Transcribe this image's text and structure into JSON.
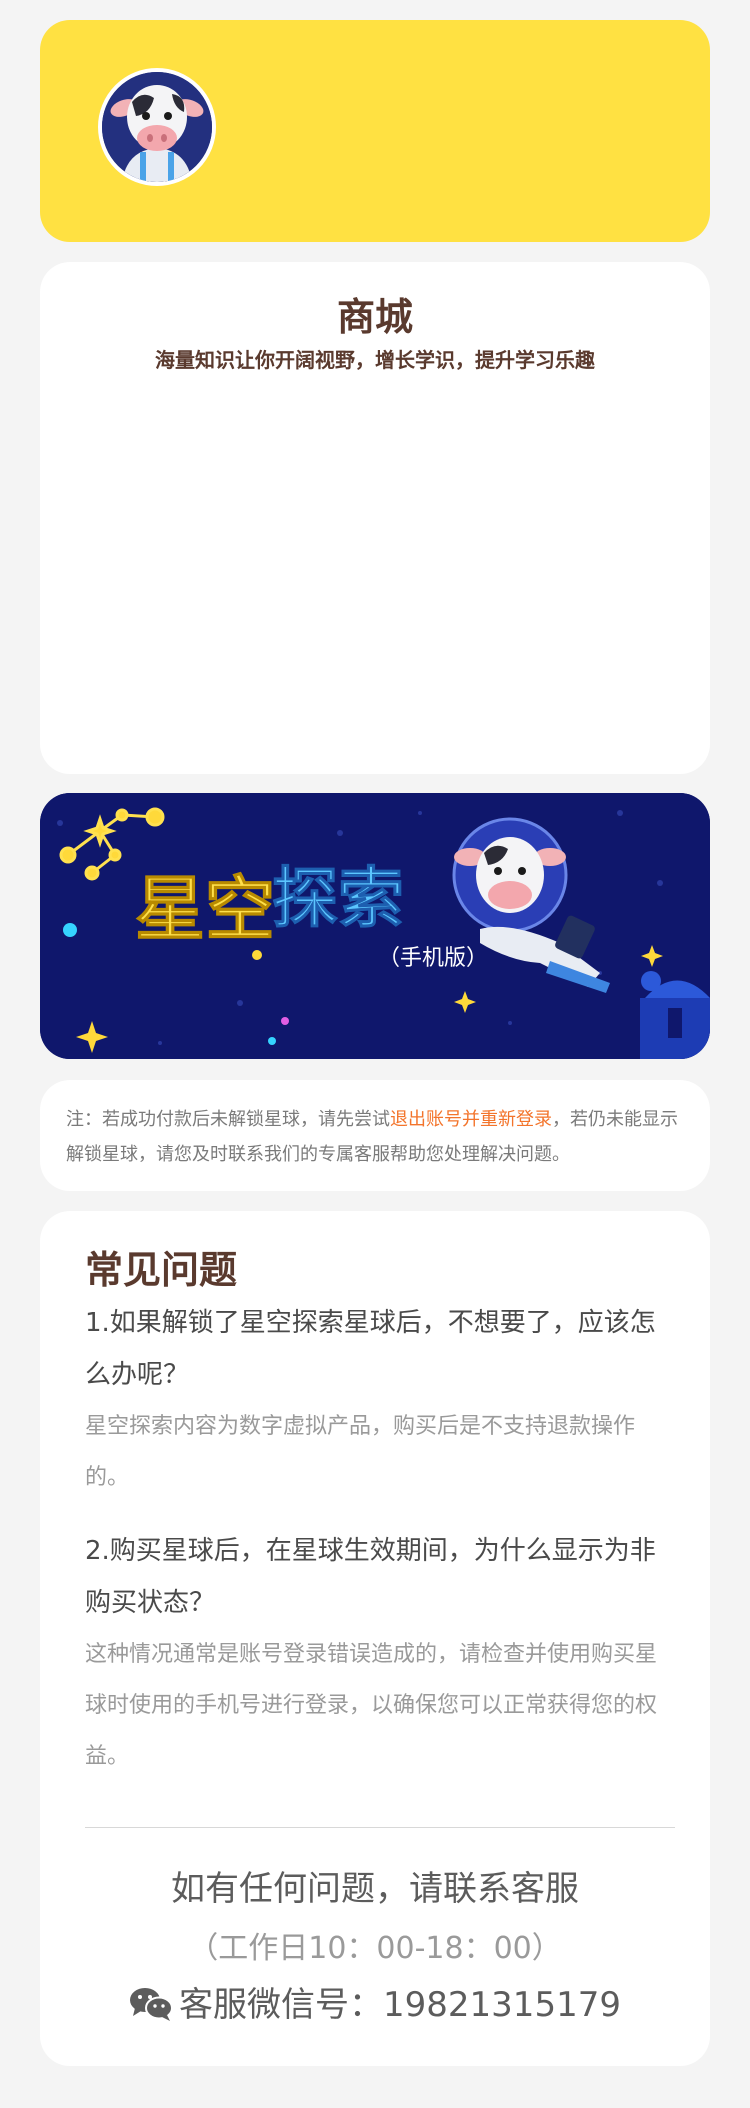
{
  "header": {
    "avatar_icon": "cow-astronaut-avatar",
    "background_color": "#ffe142"
  },
  "shop": {
    "title": "商城",
    "subtitle": "海量知识让你开阔视野，增长学识，提升学习乐趣"
  },
  "banner": {
    "title_part1": "星空",
    "title_part2": "探索",
    "edition": "（手机版）",
    "background_color": "#0f176c"
  },
  "note": {
    "text_before": "注：若成功付款后未解锁星球，请先尝试",
    "link_text": "退出账号并重新登录",
    "text_after": "，若仍未能显示解锁星球，请您及时联系我们的专属客服帮助您处理解决问题。",
    "link_color": "#f3742b"
  },
  "faq": {
    "heading": "常见问题",
    "items": [
      {
        "question": "1.如果解锁了星空探索星球后，不想要了，应该怎么办呢？",
        "answer": "星空探索内容为数字虚拟产品，购买后是不支持退款操作的。"
      },
      {
        "question": "2.购买星球后，在星球生效期间，为什么显示为非购买状态？",
        "answer": "这种情况通常是账号登录错误造成的，请检查并使用购买星球时使用的手机号进行登录，以确保您可以正常获得您的权益。"
      }
    ]
  },
  "contact": {
    "title": "如有任何问题，请联系客服",
    "hours": "（工作日10：00-18：00）",
    "wechat_label": "客服微信号：",
    "wechat_id": "19821315179",
    "wechat_icon": "wechat-icon"
  }
}
